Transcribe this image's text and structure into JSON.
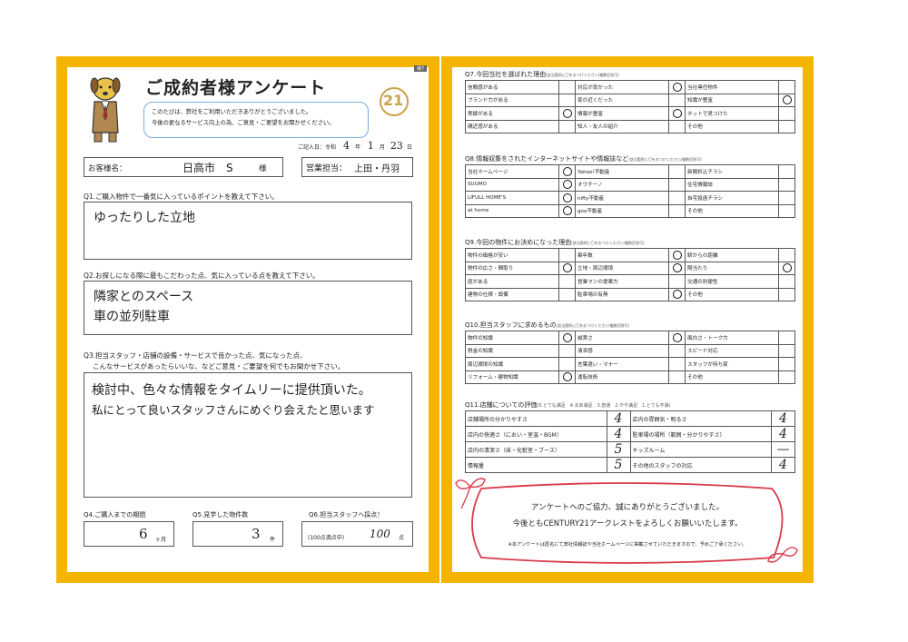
{
  "header": {
    "title": "ご成約者様アンケート",
    "tag": "様7",
    "brand": "21",
    "intro1": "このたびは、弊社をご利用いただきありがとうございました。",
    "intro2": "今後の更なるサービス向上の為、ご意見・ご要望をお聞かせください。"
  },
  "date": {
    "prefix": "ご記入日：令和",
    "year": "4",
    "year_unit": "年",
    "month": "1",
    "month_unit": "月",
    "day": "23",
    "day_unit": "日"
  },
  "customer": {
    "label": "お客様名：",
    "name": "日高市　S",
    "suffix": "様",
    "staff_label": "営業担当：",
    "staff": "上田・丹羽"
  },
  "q1": {
    "label": "Q1.ご購入物件で一番気に入っているポイントを教えて下さい。",
    "answer": "ゆったりした立地"
  },
  "q2": {
    "label": "Q2.お探しになる際に最もこだわった点、気に入っている点を教えて下さい。",
    "answers": [
      "隣家とのスペース",
      "車の並列駐車"
    ]
  },
  "q3": {
    "label1": "Q3.担当スタッフ・店舗の設備・サービスで良かった点、気になった点、",
    "label2": "こんなサービスがあったらいいな、などご意見・ご要望を何でもお聞かせ下さい。",
    "answers": [
      "検討中、色々な情報をタイムリーに提供頂いた。",
      "私にとって良いスタッフさんにめぐり会えたと思います"
    ]
  },
  "q4": {
    "label": "Q4.ご購入までの期間",
    "value": "6",
    "unit": "ヶ月"
  },
  "q5": {
    "label": "Q5.見学した物件数",
    "value": "3",
    "unit": "件"
  },
  "q6": {
    "label": "Q6.担当スタッフへ採点！",
    "prefix": "(100点満点中)",
    "value": "100",
    "unit": "点"
  },
  "q7": {
    "label": "Q7.今回当社を選ばれた理由",
    "note": "(該当箇所に〇をおつけください/複数回答可)",
    "rows": [
      [
        "信頼感がある",
        "",
        false,
        "対応が良かった",
        "",
        true,
        "当社専任物件",
        "",
        false
      ],
      [
        "ブランド力がある",
        "",
        false,
        "家の近くだった",
        "",
        false,
        "知識が豊富",
        "",
        true
      ],
      [
        "実績がある",
        "",
        true,
        "情報が豊富",
        "",
        true,
        "ネットで見つけた",
        "",
        false
      ],
      [
        "親近感がある",
        "",
        false,
        "知人・友人の紹介",
        "",
        false,
        "その他",
        "",
        false
      ]
    ]
  },
  "q8": {
    "label": "Q8.情報収集をされたインターネットサイトや情報誌など",
    "note": "(該当箇所に〇をおつけください/複数回答可)",
    "rows": [
      [
        "当社ホームページ",
        "",
        true,
        "Yahoo!不動産",
        "",
        false,
        "新聞折込チラシ",
        "",
        false
      ],
      [
        "SUUMO",
        "",
        true,
        "オウチーノ",
        "",
        false,
        "住宅情報誌",
        "",
        false
      ],
      [
        "LIFULL HOME'S",
        "",
        true,
        "nifty不動産",
        "",
        false,
        "自宅投函チラシ",
        "",
        false
      ],
      [
        "at home",
        "",
        true,
        "goo不動産",
        "",
        false,
        "その他",
        "",
        false
      ]
    ]
  },
  "q9": {
    "label": "Q9.今回の物件にお決めになった理由",
    "note": "(該当箇所に〇をおつけください/複数回答可)",
    "rows": [
      [
        "物件の価格が安い",
        "",
        false,
        "築年数",
        "",
        true,
        "駅からの距離",
        "",
        false
      ],
      [
        "物件の広さ・間取り",
        "",
        true,
        "立地・周辺環境",
        "",
        true,
        "陽当たり",
        "",
        true
      ],
      [
        "庭がある",
        "",
        false,
        "営業マンの提案力",
        "",
        false,
        "交通の利便性",
        "",
        false
      ],
      [
        "建物の仕様・設備",
        "",
        false,
        "駐車場の有無",
        "",
        true,
        "その他",
        "",
        false
      ]
    ]
  },
  "q10": {
    "label": "Q10.担当スタッフに求めるもの",
    "note": "(該当箇所に〇をおつけください/複数回答可)",
    "rows": [
      [
        "物件の知識",
        "",
        true,
        "誠実さ",
        "",
        true,
        "面白さ・トーク力",
        "",
        false
      ],
      [
        "税金の知識",
        "",
        false,
        "清潔感",
        "",
        false,
        "スピード対応",
        "",
        false
      ],
      [
        "周辺環境の知識",
        "",
        false,
        "言葉遣い・マナー",
        "",
        false,
        "スタッフが持ち家",
        "",
        false
      ],
      [
        "リフォーム・建物知識",
        "",
        true,
        "運転技術",
        "",
        false,
        "その他",
        "",
        false
      ]
    ]
  },
  "q11": {
    "label": "Q11.店舗についての評価",
    "scale": "(5.とても満足　4.まあ満足　3.普通　2.やや満足　1.とても不満)",
    "rows": [
      [
        "店舗場所の分かりやすさ",
        "4",
        "店内の雰囲気・明るさ",
        "4"
      ],
      [
        "店内の快適さ（におい・室温・BGM）",
        "4",
        "駐車場の場所（範囲・分かりやすさ）",
        "4"
      ],
      [
        "店内の清潔さ（床・化粧室・ブース）",
        "5",
        "キッズルーム",
        "—"
      ],
      [
        "情報量",
        "5",
        "その他のスタッフの対応",
        "4"
      ]
    ]
  },
  "footer": {
    "thanks1": "アンケートへのご協力、誠にありがとうございました。",
    "thanks2": "今後ともCENTURY21アークレストをよろしくお願いいたします。",
    "note": "※本アンケートは匿名にて弊社情報誌や当社ホームページに掲載させていただきますので、予めご了承ください。"
  },
  "colors": {
    "frame": "#f5b400",
    "ribbon": "#d93a4a",
    "bubble_border": "#7aaedc"
  },
  "icons": [
    "dog-mascot-icon",
    "century21-logo-icon",
    "ribbon-icon"
  ]
}
